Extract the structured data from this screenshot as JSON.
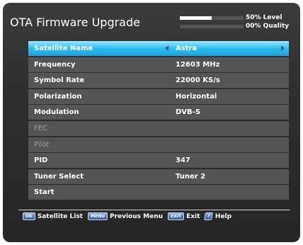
{
  "header": {
    "title": "OTA Firmware Upgrade"
  },
  "signal": {
    "level_text": "50% Level",
    "quality_text": "00% Quality",
    "level": 0.5,
    "quality": 0.0
  },
  "rows": [
    {
      "label": "Satellite Name",
      "value": "Astra"
    },
    {
      "label": "Frequency",
      "value": "12603 MHz"
    },
    {
      "label": "Symbol Rate",
      "value": "22000 KS/s"
    },
    {
      "label": "Polarization",
      "value": "Horizontal"
    },
    {
      "label": "Modulation",
      "value": "DVB-S"
    },
    {
      "label": "FEC",
      "value": ""
    },
    {
      "label": "Pilot",
      "value": ""
    },
    {
      "label": "PID",
      "value": "347"
    },
    {
      "label": "Tuner Select",
      "value": "Tuner 2"
    },
    {
      "label": "Start",
      "value": ""
    }
  ],
  "footer": [
    {
      "key": "OK",
      "label": "Satellite List"
    },
    {
      "key": "MENU",
      "label": "Previous Menu"
    },
    {
      "key": "EXIT",
      "label": "Exit"
    },
    {
      "key": "?",
      "label": "Help"
    }
  ],
  "colors": {
    "selected_row": "#2fbef0",
    "row": "#555555",
    "background": "#2e2e2e"
  }
}
